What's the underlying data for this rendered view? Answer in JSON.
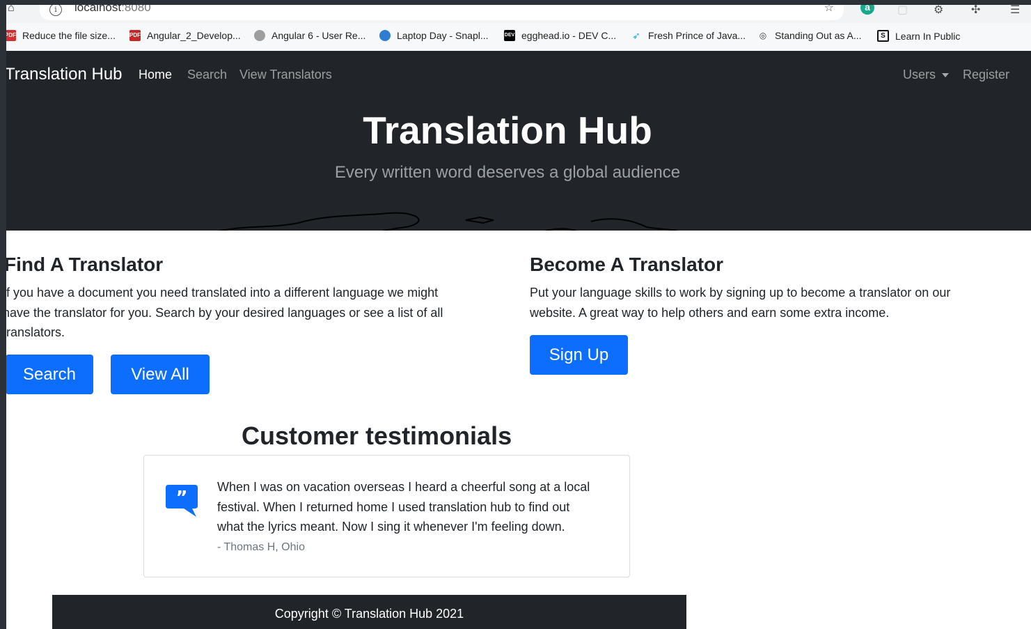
{
  "browser": {
    "url_host": "localhost",
    "url_port": ":8080",
    "bookmarks": [
      {
        "label": "Reduce the file size...",
        "icon": "pdf-icon",
        "color": "#d32f2f"
      },
      {
        "label": "Angular_2_Develop...",
        "icon": "pdf-file-icon",
        "color": "#c62828"
      },
      {
        "label": "Angular 6 - User Re...",
        "icon": "avatar-icon",
        "color": "#777777"
      },
      {
        "label": "Laptop Day - Snapl...",
        "icon": "snapl-icon",
        "color": "#2e7dd1"
      },
      {
        "label": "egghead.io - DEV C...",
        "icon": "dev-icon",
        "color": "#000000"
      },
      {
        "label": "Fresh Prince of Java...",
        "icon": "twitter-icon",
        "color": "#1da1f2"
      },
      {
        "label": "Standing Out as A...",
        "icon": "glasses-icon",
        "color": "#333333"
      },
      {
        "label": "Learn In Public",
        "icon": "swyx-icon",
        "color": "#111111"
      }
    ]
  },
  "navbar": {
    "brand": "Translation Hub",
    "links": [
      "Home",
      "Search",
      "View Translators"
    ],
    "users_label": "Users",
    "register_label": "Register"
  },
  "hero": {
    "title": "Translation Hub",
    "subtitle": "Every written word deserves a global audience"
  },
  "find": {
    "title": "Find A Translator",
    "lines": [
      "If you have a document you need translated into a different language we might",
      "have the translator for you. Search by your desired languages or see a list of all",
      "translators."
    ],
    "search_button": "Search",
    "view_all_button": "View All"
  },
  "become": {
    "title": "Become A Translator",
    "lines": [
      "Put your language skills to work by signing up to become a translator on our",
      "website. A great way to help others and earn some extra income."
    ],
    "signup_button": "Sign Up"
  },
  "testimonials": {
    "title": "Customer testimonials",
    "lines": [
      "When I was on vacation overseas I heard a cheerful song at a local",
      "festival. When I returned home I used translation hub to find out",
      "what the lyrics meant. Now I sing it whenever I'm feeling down."
    ],
    "author": "- Thomas H, Ohio"
  },
  "footer": {
    "text": "Copyright © Translation Hub 2021"
  },
  "colors": {
    "primary": "#0d6efd",
    "dark": "#212529"
  }
}
